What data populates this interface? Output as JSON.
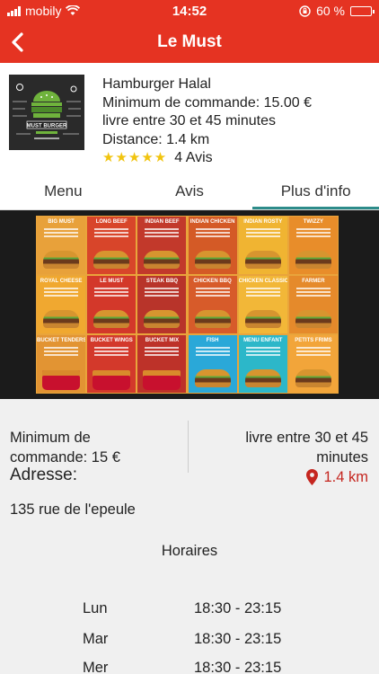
{
  "status_bar": {
    "carrier": "mobily",
    "time": "14:52",
    "battery": "60 %",
    "battery_level": 0.6
  },
  "nav": {
    "title": "Le Must"
  },
  "restaurant": {
    "logo_text": "MUST BURGER",
    "category": "Hamburger Halal",
    "min_order": "Minimum de commande: 15.00 €",
    "delivery_time": "livre entre 30 et 45 minutes",
    "distance": "Distance: 1.4 km",
    "stars": "★★★★★",
    "reviews": "4 Avis"
  },
  "tabs": [
    {
      "label": "Menu",
      "active": false
    },
    {
      "label": "Avis",
      "active": false
    },
    {
      "label": "Plus d'info",
      "active": true
    }
  ],
  "menu_board": {
    "items": [
      {
        "name": "BIG MUST",
        "color": "#e8a13a"
      },
      {
        "name": "LONG BEEF",
        "color": "#d8452a"
      },
      {
        "name": "INDIAN BEEF",
        "color": "#c2392b"
      },
      {
        "name": "INDIAN CHICKEN",
        "color": "#d45a26"
      },
      {
        "name": "INDIAN ROSTY",
        "color": "#f0b432"
      },
      {
        "name": "TWIZZY",
        "color": "#e88d2a"
      },
      {
        "name": "ROYAL CHEESE",
        "color": "#f0a830"
      },
      {
        "name": "LE MUST",
        "color": "#d3382a"
      },
      {
        "name": "STEAK BBQ",
        "color": "#b8342a"
      },
      {
        "name": "CHICKEN BBQ",
        "color": "#d75b2a"
      },
      {
        "name": "CHICKEN CLASSIC",
        "color": "#f2b738"
      },
      {
        "name": "FARMER",
        "color": "#e58a2b"
      },
      {
        "name": "BUCKET TENDERS",
        "color": "#e29433"
      },
      {
        "name": "BUCKET WINGS",
        "color": "#d3392b"
      },
      {
        "name": "BUCKET MIX",
        "color": "#bd3229"
      },
      {
        "name": "FISH",
        "color": "#2aa8d8"
      },
      {
        "name": "MENU ENFANT",
        "color": "#2cb7c9"
      },
      {
        "name": "PETITS FRIMS",
        "color": "#f2a53a"
      }
    ]
  },
  "details": {
    "min_order_line1": "Minimum de",
    "min_order_line2": "commande: 15 €",
    "delivery_line1": "livre entre 30 et 45",
    "delivery_line2": "minutes",
    "distance": "1.4 km",
    "address_label": "Adresse:",
    "address": "135 rue de l'epeule",
    "hours_title": "Horaires",
    "hours": [
      {
        "day": "Lun",
        "time": "18:30 - 23:15"
      },
      {
        "day": "Mar",
        "time": "18:30 - 23:15"
      },
      {
        "day": "Mer",
        "time": "18:30 - 23:15"
      }
    ]
  },
  "colors": {
    "primary": "#e53322",
    "tab_indicator": "#2d8c8a",
    "stars": "#f1c40f",
    "distance": "#c5261f"
  }
}
